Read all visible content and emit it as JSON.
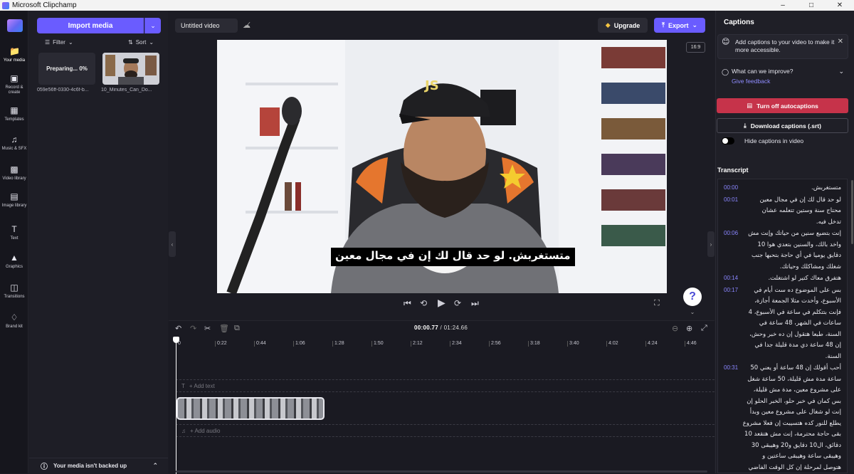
{
  "window": {
    "title": "Microsoft Clipchamp"
  },
  "rail": {
    "items": [
      {
        "label": "Your media",
        "icon": "folder-icon"
      },
      {
        "label": "Record & create",
        "icon": "camera-icon"
      },
      {
        "label": "Templates",
        "icon": "grid-icon"
      },
      {
        "label": "Music & SFX",
        "icon": "music-icon"
      },
      {
        "label": "Video library",
        "icon": "film-icon"
      },
      {
        "label": "Image library",
        "icon": "image-icon"
      },
      {
        "label": "Text",
        "icon": "text-icon"
      },
      {
        "label": "Graphics",
        "icon": "shapes-icon"
      },
      {
        "label": "Transitions",
        "icon": "transition-icon"
      },
      {
        "label": "Brand kit",
        "icon": "brand-icon"
      }
    ]
  },
  "media": {
    "import_label": "Import media",
    "filter_label": "Filter",
    "sort_label": "Sort",
    "items": [
      {
        "name": "059e56ff-0330-4c6f-b...",
        "status": "Preparing... 0%"
      },
      {
        "name": "10_Minutes_Can_Do..."
      }
    ],
    "backup_text": "Your media isn't backed up"
  },
  "editor": {
    "project_title": "Untitled video",
    "upgrade_label": "Upgrade",
    "export_label": "Export",
    "aspect_ratio": "16:9",
    "caption_text": "متستغربش. لو حد قال لك إن في مجال معين",
    "help_label": "?"
  },
  "timeline": {
    "current_time": "00:00.77",
    "total_time": "01:24.66",
    "ticks": [
      "0",
      "0:22",
      "0:44",
      "1:06",
      "1:28",
      "1:50",
      "2:12",
      "2:34",
      "2:56",
      "3:18",
      "3:40",
      "4:02",
      "4:24",
      "4:46"
    ],
    "add_text_label": "+ Add text",
    "add_audio_label": "+ Add audio"
  },
  "captions_panel": {
    "title": "Captions",
    "note": "Add captions to your video to make it more accessible.",
    "improve_title": "What can we improve?",
    "improve_link": "Give feedback",
    "turn_off_label": "Turn off autocaptions",
    "download_label": "Download captions (.srt)",
    "hide_label": "Hide captions in video",
    "transcript_title": "Transcript",
    "segments": [
      {
        "time": "00:00",
        "lines": [
          "متستغربش."
        ]
      },
      {
        "time": "00:01",
        "lines": [
          "لو حد قال لك إن في مجال معين",
          "محتاج سنة وستين تتعلمه عشان",
          "تدخل فيه."
        ]
      },
      {
        "time": "00:06",
        "lines": [
          "إنت بتضيع سنين من حياتك وإنت مش",
          "واخد بالك، والسنين بتعدي هوا 10",
          "دقايق يوميا في أي حاجة بتحبها جنب",
          "شغلك ومشاكلك وحياتك."
        ]
      },
      {
        "time": "00:14",
        "lines": [
          "هتفرق معاك كتير لو اشتغلت."
        ]
      },
      {
        "time": "00:17",
        "lines": [
          "بس على الموضوع ده ست أيام في",
          "الأسبوع، وأخدت مثلا الجمعة أجازة،",
          "فإنت بتتكلم في ساعة في الأسبوع، 4",
          "ساعات في الشهر، 48 ساعة في",
          "السنة، طبعا هتقول إن ده خبر وحش،",
          "إن 48 ساعة دي مدة قليلة جدا في",
          "السنة."
        ]
      },
      {
        "time": "00:31",
        "lines": [
          "أحب أقولك إن 48 ساعة أو يعني 50",
          "ساعة مدة مش قليلة، 50 ساعة شغل",
          "على مشروع معين، مدة مش قليلة،",
          "بس كمان في خبر حلو، الخبر الحلو إن",
          "إنت لو شغال على مشروع معين وبدأ",
          "يطلع للنور كده هتسيبت إن فعلا مشروع",
          "بقى حاجة محترمة، إنت مش هتقعد 10",
          "دقائق، ال10 دقايق و20 وهيبقى 30",
          "وهيبقى ساعة وهيبقى ساعتين و",
          "هتوصل لمرحلة إن كل الوقت الفاضي"
        ]
      }
    ]
  }
}
